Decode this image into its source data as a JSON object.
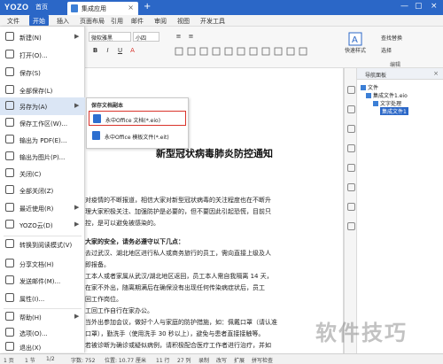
{
  "titlebar": {
    "logo": "YOZO",
    "home_tab": "首页",
    "doc_tab": "集成应用",
    "plus": "+",
    "close": "×",
    "controls": [
      "—",
      "▢",
      "×"
    ]
  },
  "menubar": {
    "items": [
      "文件",
      "开始",
      "插入",
      "页面布局",
      "引用",
      "邮件",
      "审阅",
      "视图",
      "开发工具"
    ],
    "active_index": 1
  },
  "ribbon": {
    "font_name": "微软雅黑",
    "font_size": "小四",
    "buttons": [
      "B",
      "I",
      "U",
      "A",
      "≡",
      "≡"
    ],
    "quick_styles": "快速样式",
    "find_replace": "查找替换",
    "select": "选择",
    "edit_label": "编辑"
  },
  "file_menu": {
    "items": [
      {
        "label": "新建(N)",
        "arrow": "▶"
      },
      {
        "label": "打开(O)...",
        "arrow": ""
      },
      {
        "label": "保存(S)",
        "arrow": ""
      },
      {
        "label": "全部保存(L)",
        "arrow": ""
      },
      {
        "label": "另存为(A)",
        "arrow": "▶"
      },
      {
        "label": "保存工作区(W)...",
        "arrow": ""
      },
      {
        "label": "输出为 PDF(E)...",
        "arrow": ""
      },
      {
        "label": "输出为图片(P)...",
        "arrow": ""
      },
      {
        "label": "关闭(C)",
        "arrow": ""
      },
      {
        "label": "全部关闭(Z)",
        "arrow": ""
      },
      {
        "label": "最近使用(R)",
        "arrow": "▶"
      },
      {
        "label": "YOZO云(D)",
        "arrow": "▶"
      },
      {
        "label": "转换到阅读模式(V)",
        "arrow": ""
      },
      {
        "label": "分享文档(H)",
        "arrow": ""
      },
      {
        "label": "发送邮件(M)...",
        "arrow": ""
      },
      {
        "label": "属性(I)...",
        "arrow": ""
      },
      {
        "label": "帮助(H)",
        "arrow": "▶"
      },
      {
        "label": "选项(O)...",
        "arrow": ""
      },
      {
        "label": "退出(X)",
        "arrow": ""
      }
    ],
    "highlight_index": 4
  },
  "submenu": {
    "title": "保存文档副本",
    "items": [
      {
        "label": "永中Office 文档(*.eio)"
      },
      {
        "label": "永中Office 模板文件(*.eit)"
      }
    ],
    "selected_index": 0
  },
  "document": {
    "title": "新型冠状病毒肺炎防控通知",
    "paragraphs": [
      {
        "text": "对疫情的不断报道，相信大家对新型冠状病毒的关注程度也在不断升",
        "bold": false
      },
      {
        "text": "理大家积极关注、加强防护是必要的，但不要因此引起恐慌，目前只",
        "bold": false
      },
      {
        "text": "控，是可以避免被感染的。",
        "bold": false
      },
      {
        "text": "大家的安全，请务必遵守以下几点：",
        "bold": true
      },
      {
        "text": "去过武汉、湖北地区进行私人或商务旅行的员工，需向直接上级及人",
        "bold": false
      },
      {
        "text": "即报备。",
        "bold": false
      },
      {
        "text": "工本人或者家属从武汉/湖北地区返回，员工本人需自我隔离 14 天，",
        "bold": false
      },
      {
        "text": "在家不外出，随离期满后在确保没有出现任何传染病症状后，员工",
        "bold": false
      },
      {
        "text": "回工作岗位。",
        "bold": false
      },
      {
        "text": "工回工作自行在家办公。",
        "bold": false
      },
      {
        "text": "当外出参加会议，做好个人与家庭的防护措施，如：佩戴口罩（请认准",
        "bold": false
      },
      {
        "text": "口罩），勤洗手（使用洗手 30 秒以上），避免与患者直接接触等。",
        "bold": false
      },
      {
        "text": "若被诊断为确诊或疑似病例，请积极配合医疗工作者进行治疗，并如",
        "bold": false
      }
    ]
  },
  "nav_pane": {
    "title": "导航面板",
    "root": "文件",
    "file": "集成文件1.eio",
    "folder": "文字处理",
    "selected": "集成文件1"
  },
  "status_bar": {
    "items": [
      "1 页",
      "1 节",
      "1/2",
      "字数: 752",
      "位置: 10.77 厘米",
      "11 行",
      "27 列",
      "录制",
      "改写",
      "扩展",
      "拼写检查"
    ]
  },
  "watermark": "软件技巧",
  "colors": {
    "accent": "#2b67c7",
    "selection_border": "#d9332b",
    "menu_highlight": "#dbe6f5"
  }
}
